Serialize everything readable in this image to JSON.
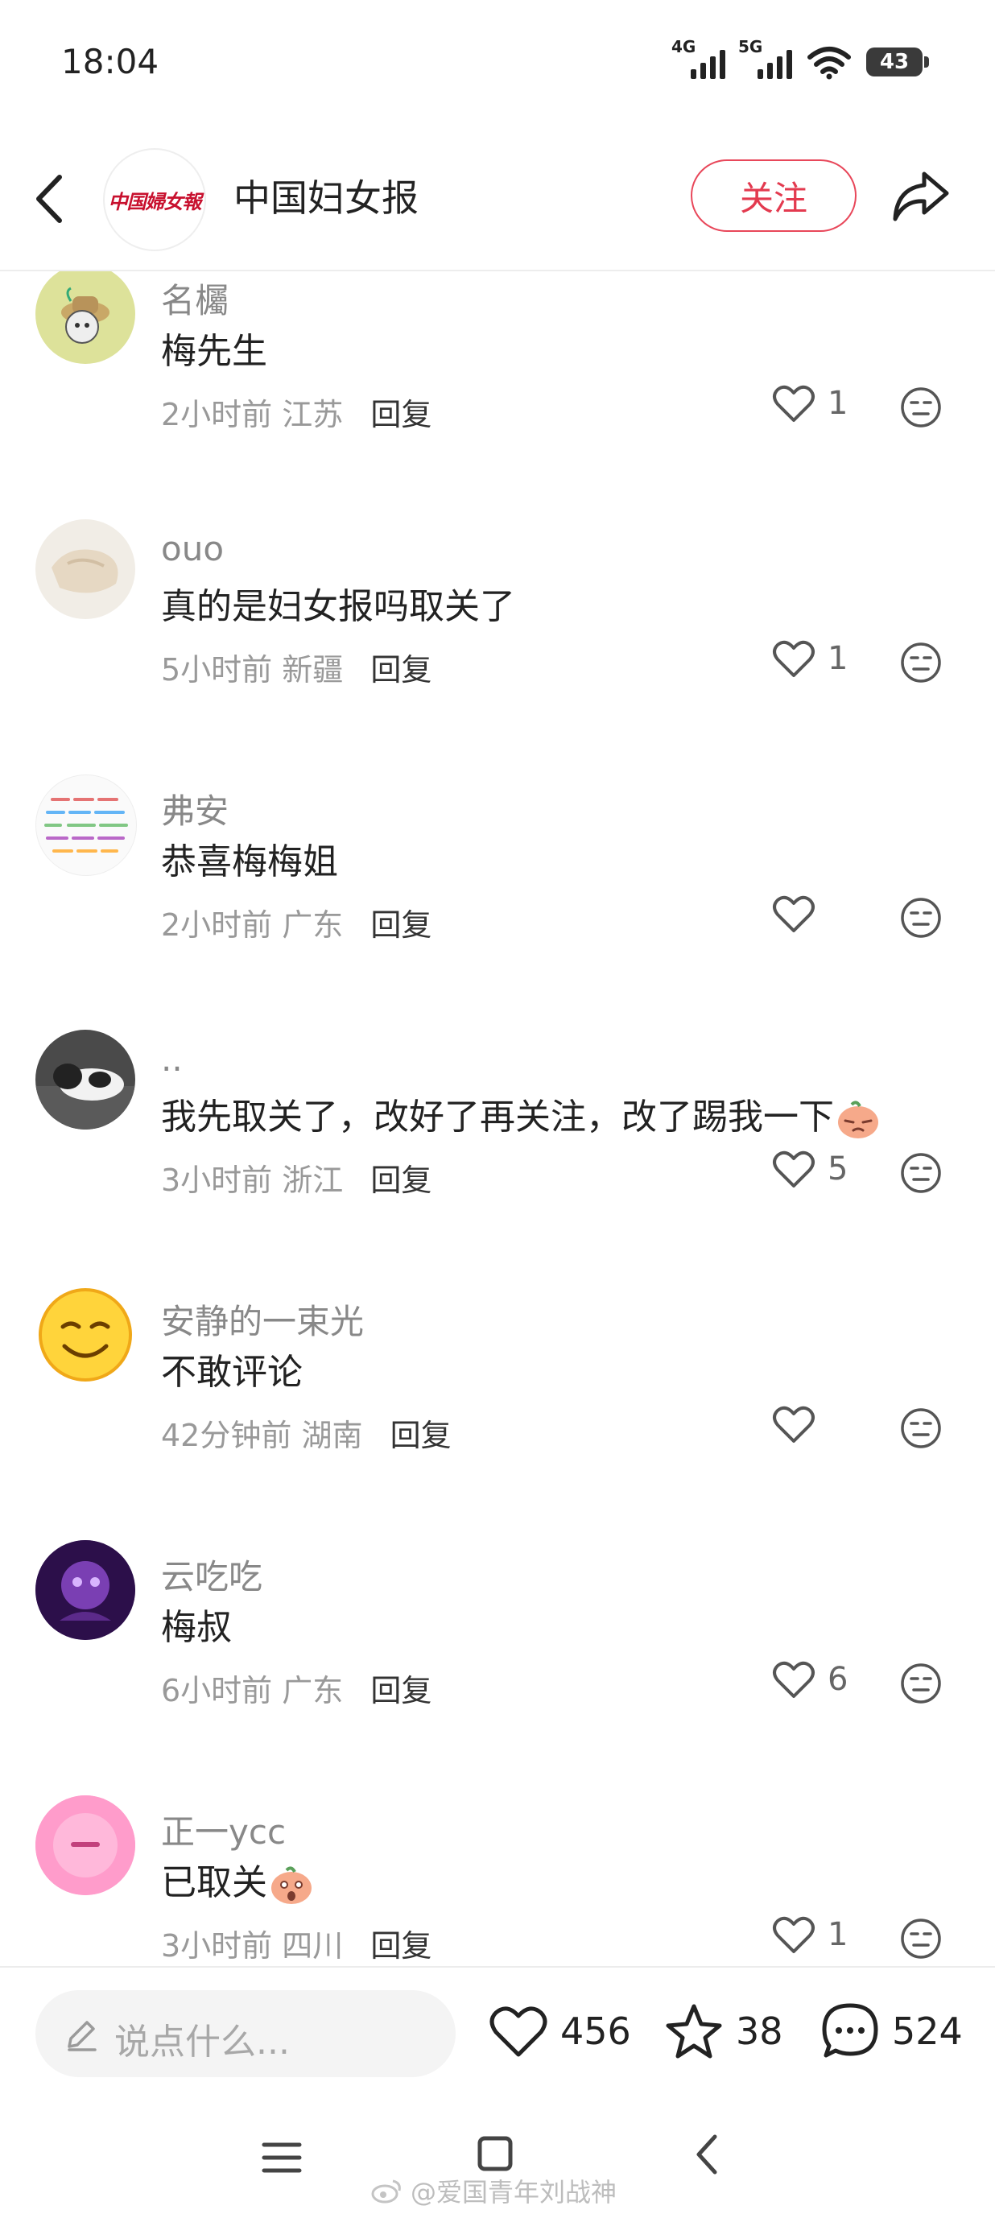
{
  "status_bar": {
    "time": "18:04",
    "net1": "4G",
    "net2": "5G",
    "battery": "43"
  },
  "header": {
    "title": "中国妇女报",
    "follow_label": "关注",
    "logo_text": "中国婦女報"
  },
  "comments": [
    {
      "name": "名欘",
      "text": "梅先生",
      "time": "2小时前",
      "location": "江苏",
      "reply": "回复",
      "likes": "1"
    },
    {
      "name": "ouo",
      "text": "真的是妇女报吗取关了",
      "time": "5小时前",
      "location": "新疆",
      "reply": "回复",
      "likes": "1"
    },
    {
      "name": "弗安",
      "text": "恭喜梅梅姐",
      "time": "2小时前",
      "location": "广东",
      "reply": "回复",
      "likes": ""
    },
    {
      "name": "..",
      "text": "我先取关了，改好了再关注，改了踢我一下",
      "time": "3小时前",
      "location": "浙江",
      "reply": "回复",
      "likes": "5"
    },
    {
      "name": "安静的一束光",
      "text": "不敢评论",
      "time": "42分钟前",
      "location": "湖南",
      "reply": "回复",
      "likes": ""
    },
    {
      "name": "云吃吃",
      "text": "梅叔",
      "time": "6小时前",
      "location": "广东",
      "reply": "回复",
      "likes": "6"
    },
    {
      "name": "正一ycc",
      "text": "已取关",
      "time": "3小时前",
      "location": "四川",
      "reply": "回复",
      "likes": "1"
    }
  ],
  "bottom_bar": {
    "input_placeholder": "说点什么...",
    "likes_count": "456",
    "favorites_count": "38",
    "comments_count": "524"
  },
  "watermark": "@爱国青年刘战神",
  "colors": {
    "accent": "#e33a4f",
    "text_primary": "#222222",
    "text_secondary": "#888888"
  }
}
